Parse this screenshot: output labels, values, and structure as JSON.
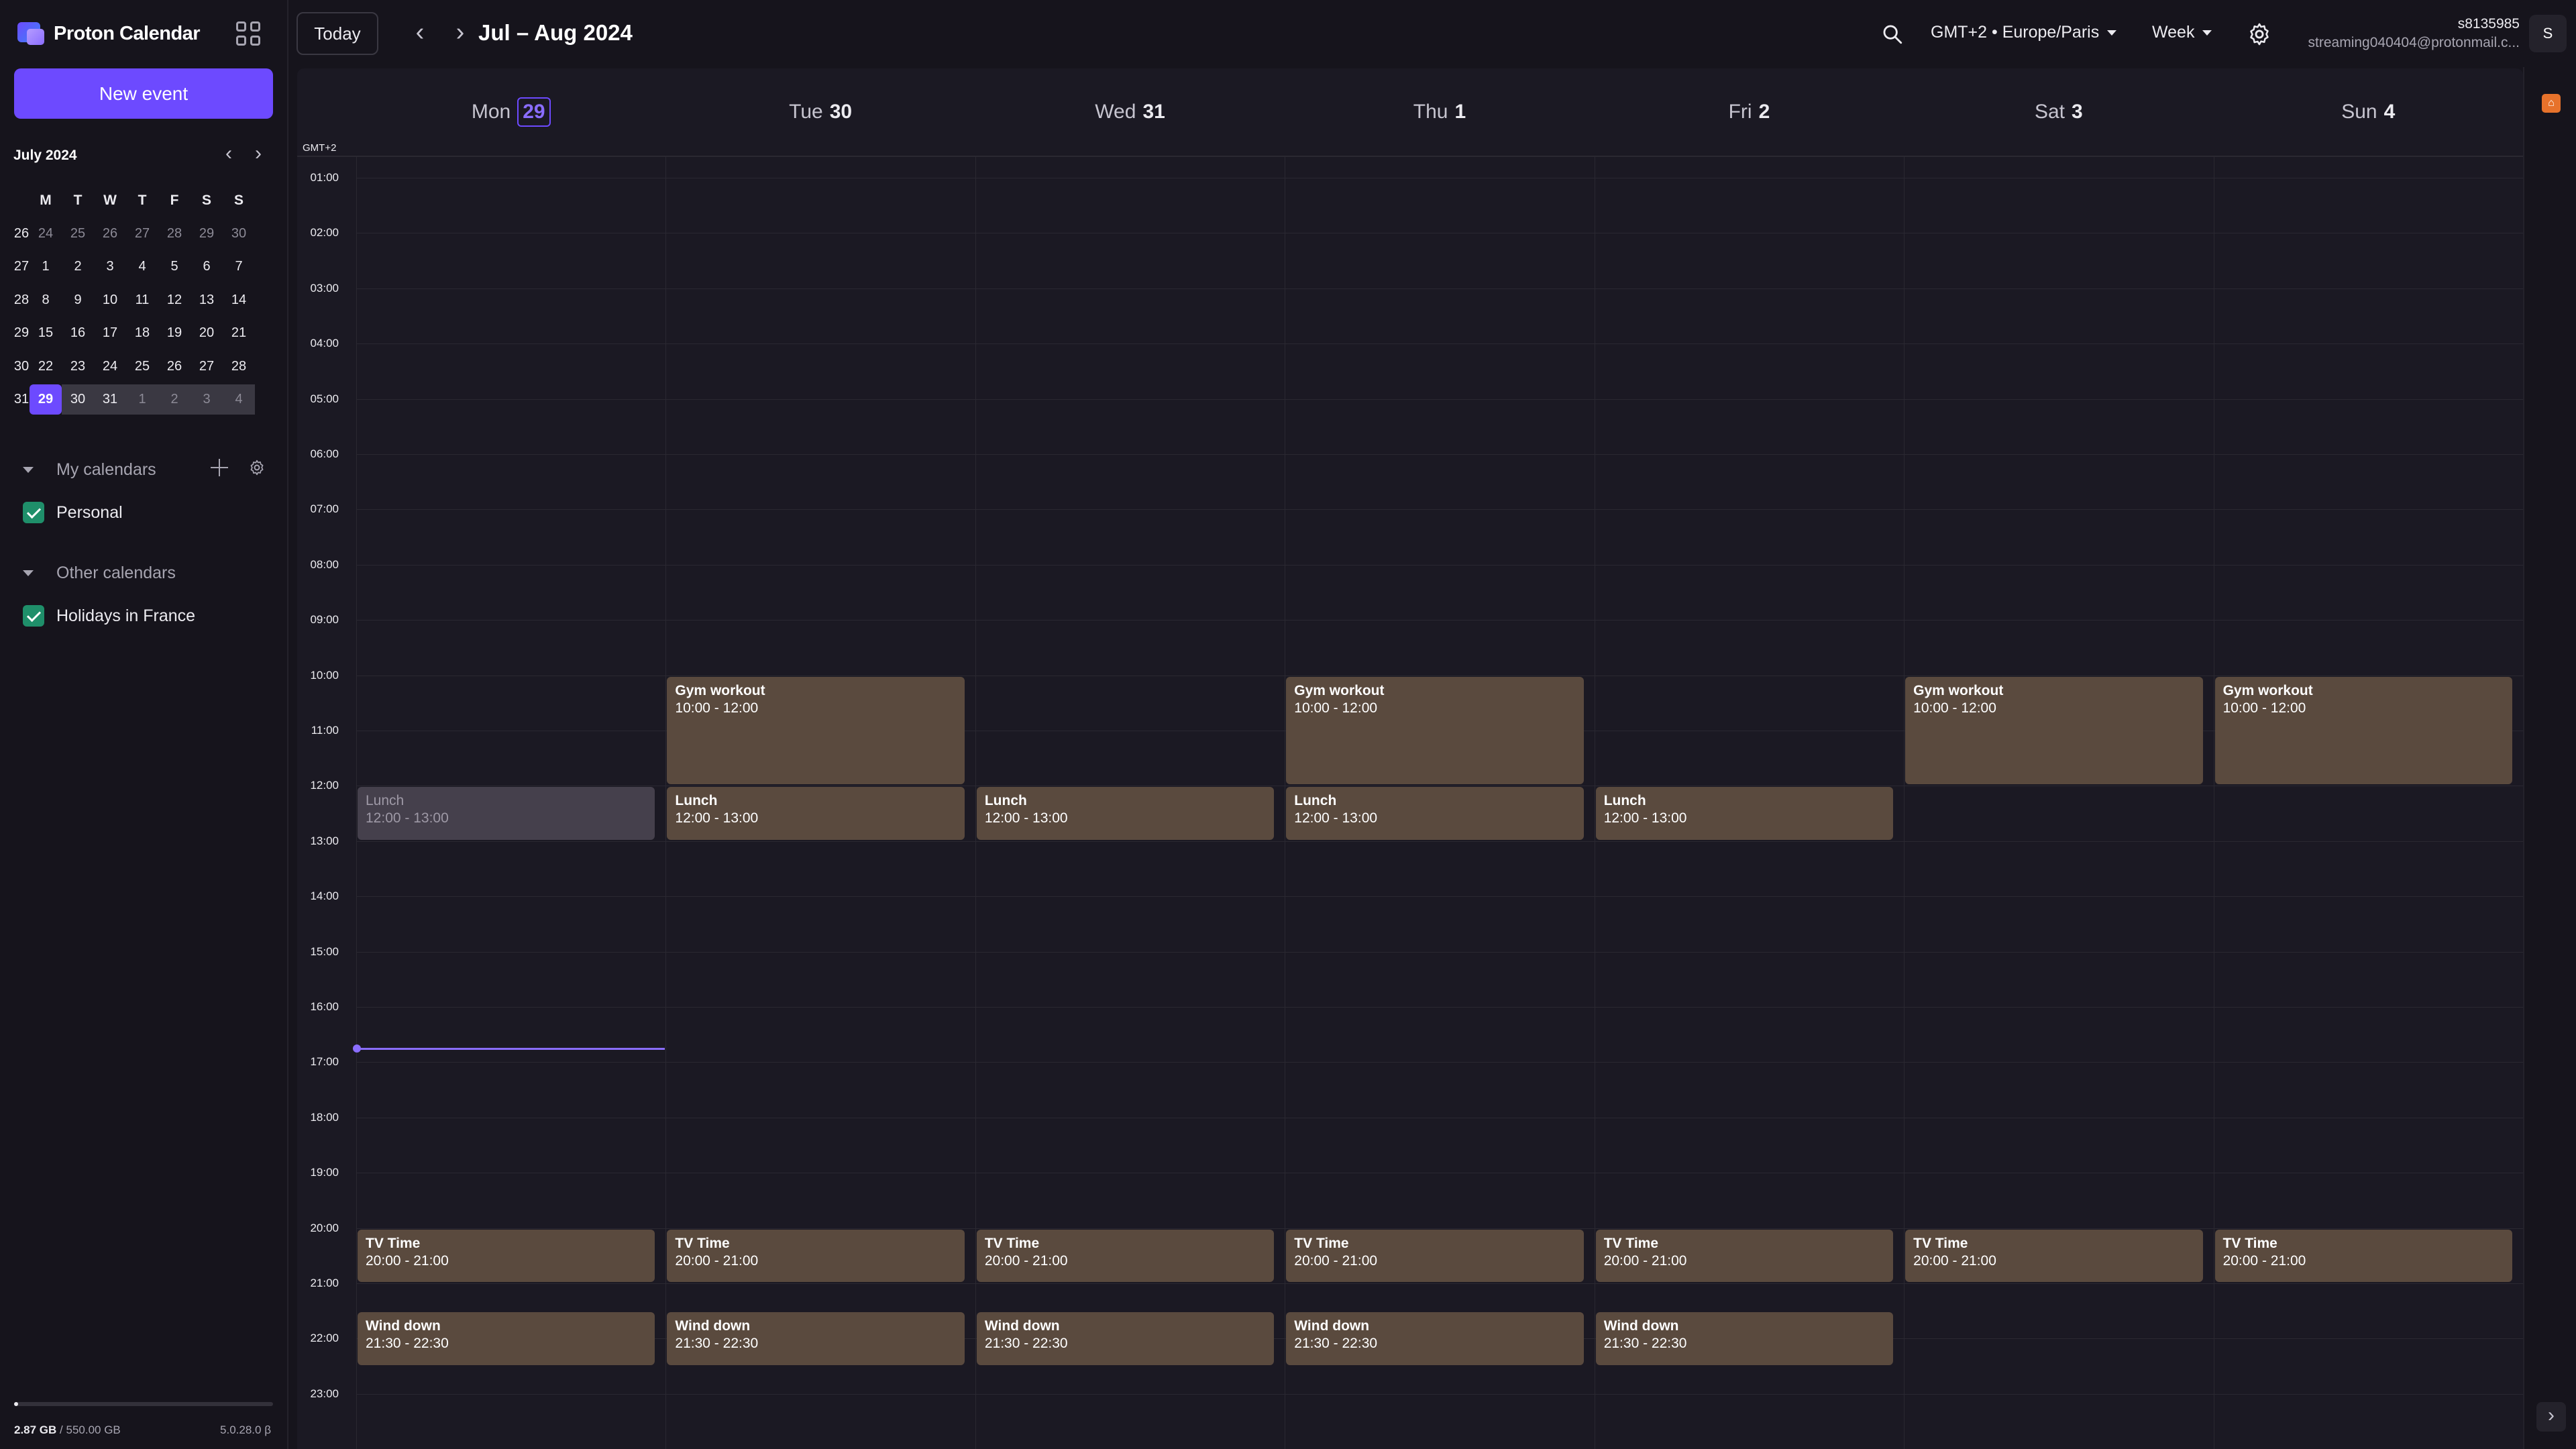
{
  "app": {
    "name": "Proton Calendar"
  },
  "sidebar": {
    "new_event_label": "New event",
    "mini_calendar": {
      "title": "July 2024",
      "weekday_headers": [
        "M",
        "T",
        "W",
        "T",
        "F",
        "S",
        "S"
      ],
      "weeks": [
        {
          "week": "26",
          "days": [
            "24",
            "25",
            "26",
            "27",
            "28",
            "29",
            "30"
          ]
        },
        {
          "week": "27",
          "days": [
            "1",
            "2",
            "3",
            "4",
            "5",
            "6",
            "7"
          ]
        },
        {
          "week": "28",
          "days": [
            "8",
            "9",
            "10",
            "11",
            "12",
            "13",
            "14"
          ]
        },
        {
          "week": "29",
          "days": [
            "15",
            "16",
            "17",
            "18",
            "19",
            "20",
            "21"
          ]
        },
        {
          "week": "30",
          "days": [
            "22",
            "23",
            "24",
            "25",
            "26",
            "27",
            "28"
          ]
        },
        {
          "week": "31",
          "days": [
            "29",
            "30",
            "31",
            "1",
            "2",
            "3",
            "4"
          ]
        }
      ],
      "today": "29"
    },
    "my_calendars_label": "My calendars",
    "my_calendars": [
      {
        "name": "Personal",
        "color": "#1f8f6a"
      }
    ],
    "other_calendars_label": "Other calendars",
    "other_calendars": [
      {
        "name": "Holidays in France",
        "color": "#1f8f6a"
      }
    ],
    "storage_used": "2.87 GB",
    "storage_total": "/ 550.00 GB",
    "storage_fraction": 0.005,
    "version": "5.0.28.0 β"
  },
  "topbar": {
    "today_label": "Today",
    "range_title": "Jul – Aug 2024",
    "timezone": "GMT+2 • Europe/Paris",
    "view": "Week",
    "user_name": "s8135985",
    "user_email": "streaming040404@protonmail.c...",
    "avatar_initial": "S"
  },
  "calendar": {
    "timezone_label": "GMT+2",
    "days": [
      {
        "name": "Mon",
        "num": "29",
        "today": true
      },
      {
        "name": "Tue",
        "num": "30"
      },
      {
        "name": "Wed",
        "num": "31"
      },
      {
        "name": "Thu",
        "num": "1"
      },
      {
        "name": "Fri",
        "num": "2"
      },
      {
        "name": "Sat",
        "num": "3"
      },
      {
        "name": "Sun",
        "num": "4"
      }
    ],
    "hours": [
      "01:00",
      "02:00",
      "03:00",
      "04:00",
      "05:00",
      "06:00",
      "07:00",
      "08:00",
      "09:00",
      "10:00",
      "11:00",
      "12:00",
      "13:00",
      "14:00",
      "15:00",
      "16:00",
      "17:00",
      "18:00",
      "19:00",
      "20:00",
      "21:00",
      "22:00",
      "23:00"
    ],
    "current_time": "16:45",
    "events": [
      {
        "day": 1,
        "title": "Gym workout",
        "time": "10:00 - 12:00",
        "start": 10,
        "end": 12
      },
      {
        "day": 3,
        "title": "Gym workout",
        "time": "10:00 - 12:00",
        "start": 10,
        "end": 12
      },
      {
        "day": 5,
        "title": "Gym workout",
        "time": "10:00 - 12:00",
        "start": 10,
        "end": 12
      },
      {
        "day": 6,
        "title": "Gym workout",
        "time": "10:00 - 12:00",
        "start": 10,
        "end": 12
      },
      {
        "day": 0,
        "title": "Lunch",
        "time": "12:00 - 13:00",
        "start": 12,
        "end": 13,
        "past": true
      },
      {
        "day": 1,
        "title": "Lunch",
        "time": "12:00 - 13:00",
        "start": 12,
        "end": 13
      },
      {
        "day": 2,
        "title": "Lunch",
        "time": "12:00 - 13:00",
        "start": 12,
        "end": 13
      },
      {
        "day": 3,
        "title": "Lunch",
        "time": "12:00 - 13:00",
        "start": 12,
        "end": 13
      },
      {
        "day": 4,
        "title": "Lunch",
        "time": "12:00 - 13:00",
        "start": 12,
        "end": 13
      },
      {
        "day": 0,
        "title": "TV Time",
        "time": "20:00 - 21:00",
        "start": 20,
        "end": 21
      },
      {
        "day": 1,
        "title": "TV Time",
        "time": "20:00 - 21:00",
        "start": 20,
        "end": 21
      },
      {
        "day": 2,
        "title": "TV Time",
        "time": "20:00 - 21:00",
        "start": 20,
        "end": 21
      },
      {
        "day": 3,
        "title": "TV Time",
        "time": "20:00 - 21:00",
        "start": 20,
        "end": 21
      },
      {
        "day": 4,
        "title": "TV Time",
        "time": "20:00 - 21:00",
        "start": 20,
        "end": 21
      },
      {
        "day": 5,
        "title": "TV Time",
        "time": "20:00 - 21:00",
        "start": 20,
        "end": 21
      },
      {
        "day": 6,
        "title": "TV Time",
        "time": "20:00 - 21:00",
        "start": 20,
        "end": 21
      },
      {
        "day": 0,
        "title": "Wind down",
        "time": "21:30 - 22:30",
        "start": 21.5,
        "end": 22.5
      },
      {
        "day": 1,
        "title": "Wind down",
        "time": "21:30 - 22:30",
        "start": 21.5,
        "end": 22.5
      },
      {
        "day": 2,
        "title": "Wind down",
        "time": "21:30 - 22:30",
        "start": 21.5,
        "end": 22.5
      },
      {
        "day": 3,
        "title": "Wind down",
        "time": "21:30 - 22:30",
        "start": 21.5,
        "end": 22.5
      },
      {
        "day": 4,
        "title": "Wind down",
        "time": "21:30 - 22:30",
        "start": 21.5,
        "end": 22.5
      }
    ],
    "event_color": "#5a4a3e"
  },
  "right_rail": {
    "badge_icon": "notification-icon"
  }
}
